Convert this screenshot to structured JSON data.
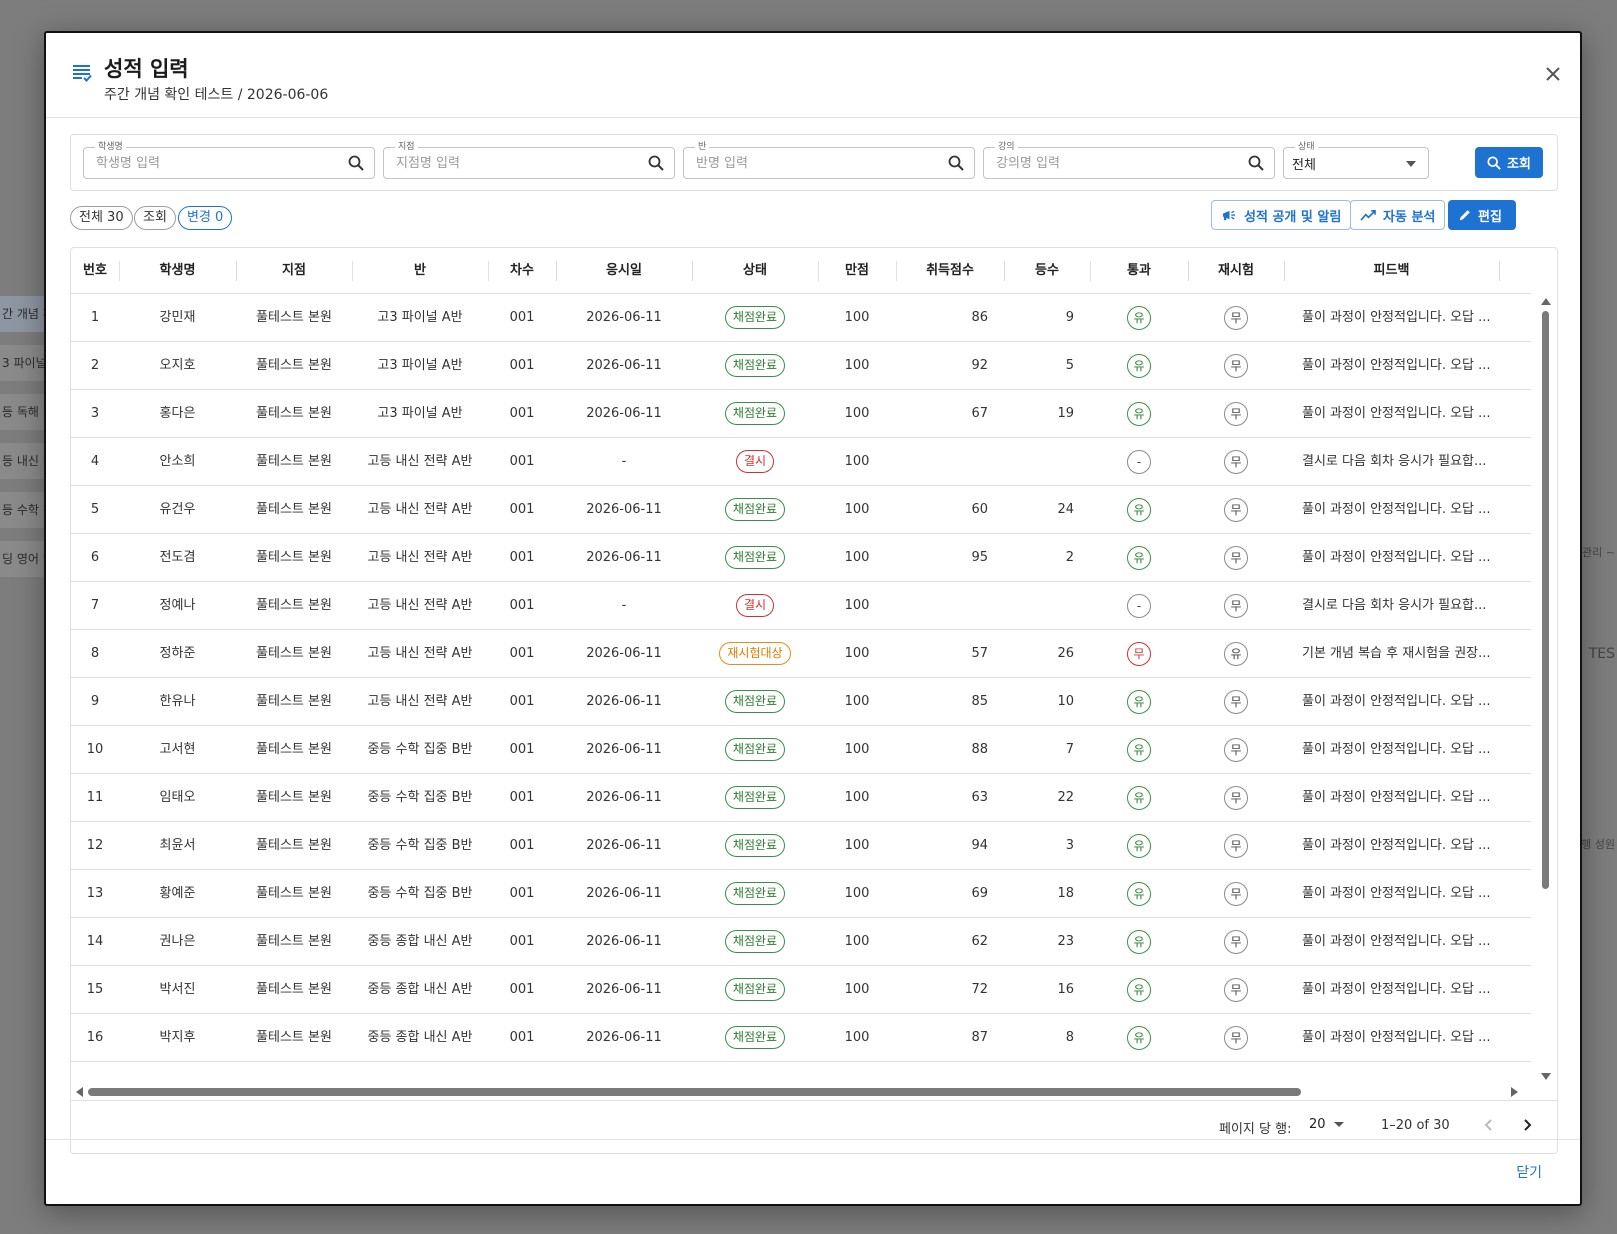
{
  "background": {
    "left_items": [
      "간 개념 확",
      "3 파이널",
      "등 독해 리",
      "등 내신 D",
      "등 수학 집",
      "딩 영어 단"
    ],
    "right_texts": [
      "관리 ~",
      "TES",
      "발행 성원"
    ]
  },
  "dialog": {
    "icon": "list-check-icon",
    "title": "성적 입력",
    "subtitle": "주간 개념 확인 테스트 / 2026-06-06",
    "close_icon": "close-icon"
  },
  "filters": {
    "student": {
      "label": "학생명",
      "placeholder": "학생명 입력",
      "value": ""
    },
    "branch": {
      "label": "지점",
      "placeholder": "지점명 입력",
      "value": ""
    },
    "class": {
      "label": "반",
      "placeholder": "반명 입력",
      "value": ""
    },
    "lecture": {
      "label": "강의",
      "placeholder": "강의명 입력",
      "value": ""
    },
    "status": {
      "label": "상태",
      "value": "전체"
    },
    "query_button": "조회"
  },
  "chips": {
    "total": "전체 30",
    "viewed": "조회",
    "changed": "변경 0"
  },
  "actions": {
    "publish": "성적 공개 및 알림",
    "analyze": "자동 분석",
    "edit": "편집"
  },
  "table": {
    "columns": [
      "번호",
      "학생명",
      "지점",
      "반",
      "차수",
      "응시일",
      "상태",
      "만점",
      "취득점수",
      "등수",
      "통과",
      "재시험",
      "피드백"
    ],
    "rows": [
      {
        "no": "1",
        "name": "강민재",
        "branch": "풀테스트 본원",
        "cls": "고3 파이널 A반",
        "round": "001",
        "date": "2026-06-11",
        "status": "채점완료",
        "status_color": "green",
        "full": "100",
        "score": "86",
        "rank": "9",
        "pass": "유",
        "pass_color": "green",
        "retest": "무",
        "feedback": "풀이 과정이 안정적입니다. 오답 ..."
      },
      {
        "no": "2",
        "name": "오지호",
        "branch": "풀테스트 본원",
        "cls": "고3 파이널 A반",
        "round": "001",
        "date": "2026-06-11",
        "status": "채점완료",
        "status_color": "green",
        "full": "100",
        "score": "92",
        "rank": "5",
        "pass": "유",
        "pass_color": "green",
        "retest": "무",
        "feedback": "풀이 과정이 안정적입니다. 오답 ..."
      },
      {
        "no": "3",
        "name": "홍다은",
        "branch": "풀테스트 본원",
        "cls": "고3 파이널 A반",
        "round": "001",
        "date": "2026-06-11",
        "status": "채점완료",
        "status_color": "green",
        "full": "100",
        "score": "67",
        "rank": "19",
        "pass": "유",
        "pass_color": "green",
        "retest": "무",
        "feedback": "풀이 과정이 안정적입니다. 오답 ..."
      },
      {
        "no": "4",
        "name": "안소희",
        "branch": "풀테스트 본원",
        "cls": "고등 내신 전략 A반",
        "round": "001",
        "date": "-",
        "status": "결시",
        "status_color": "red",
        "full": "100",
        "score": "",
        "rank": "",
        "pass": "-",
        "pass_color": "gray",
        "retest": "무",
        "feedback": "결시로 다음 회차 응시가 필요합..."
      },
      {
        "no": "5",
        "name": "유건우",
        "branch": "풀테스트 본원",
        "cls": "고등 내신 전략 A반",
        "round": "001",
        "date": "2026-06-11",
        "status": "채점완료",
        "status_color": "green",
        "full": "100",
        "score": "60",
        "rank": "24",
        "pass": "유",
        "pass_color": "green",
        "retest": "무",
        "feedback": "풀이 과정이 안정적입니다. 오답 ..."
      },
      {
        "no": "6",
        "name": "전도겸",
        "branch": "풀테스트 본원",
        "cls": "고등 내신 전략 A반",
        "round": "001",
        "date": "2026-06-11",
        "status": "채점완료",
        "status_color": "green",
        "full": "100",
        "score": "95",
        "rank": "2",
        "pass": "유",
        "pass_color": "green",
        "retest": "무",
        "feedback": "풀이 과정이 안정적입니다. 오답 ..."
      },
      {
        "no": "7",
        "name": "정예나",
        "branch": "풀테스트 본원",
        "cls": "고등 내신 전략 A반",
        "round": "001",
        "date": "-",
        "status": "결시",
        "status_color": "red",
        "full": "100",
        "score": "",
        "rank": "",
        "pass": "-",
        "pass_color": "gray",
        "retest": "무",
        "feedback": "결시로 다음 회차 응시가 필요합..."
      },
      {
        "no": "8",
        "name": "정하준",
        "branch": "풀테스트 본원",
        "cls": "고등 내신 전략 A반",
        "round": "001",
        "date": "2026-06-11",
        "status": "재시험대상",
        "status_color": "orange",
        "full": "100",
        "score": "57",
        "rank": "26",
        "pass": "무",
        "pass_color": "red",
        "retest": "유",
        "feedback": "기본 개념 복습 후 재시험을 권장..."
      },
      {
        "no": "9",
        "name": "한유나",
        "branch": "풀테스트 본원",
        "cls": "고등 내신 전략 A반",
        "round": "001",
        "date": "2026-06-11",
        "status": "채점완료",
        "status_color": "green",
        "full": "100",
        "score": "85",
        "rank": "10",
        "pass": "유",
        "pass_color": "green",
        "retest": "무",
        "feedback": "풀이 과정이 안정적입니다. 오답 ..."
      },
      {
        "no": "10",
        "name": "고서현",
        "branch": "풀테스트 본원",
        "cls": "중등 수학 집중 B반",
        "round": "001",
        "date": "2026-06-11",
        "status": "채점완료",
        "status_color": "green",
        "full": "100",
        "score": "88",
        "rank": "7",
        "pass": "유",
        "pass_color": "green",
        "retest": "무",
        "feedback": "풀이 과정이 안정적입니다. 오답 ..."
      },
      {
        "no": "11",
        "name": "임태오",
        "branch": "풀테스트 본원",
        "cls": "중등 수학 집중 B반",
        "round": "001",
        "date": "2026-06-11",
        "status": "채점완료",
        "status_color": "green",
        "full": "100",
        "score": "63",
        "rank": "22",
        "pass": "유",
        "pass_color": "green",
        "retest": "무",
        "feedback": "풀이 과정이 안정적입니다. 오답 ..."
      },
      {
        "no": "12",
        "name": "최윤서",
        "branch": "풀테스트 본원",
        "cls": "중등 수학 집중 B반",
        "round": "001",
        "date": "2026-06-11",
        "status": "채점완료",
        "status_color": "green",
        "full": "100",
        "score": "94",
        "rank": "3",
        "pass": "유",
        "pass_color": "green",
        "retest": "무",
        "feedback": "풀이 과정이 안정적입니다. 오답 ..."
      },
      {
        "no": "13",
        "name": "황예준",
        "branch": "풀테스트 본원",
        "cls": "중등 수학 집중 B반",
        "round": "001",
        "date": "2026-06-11",
        "status": "채점완료",
        "status_color": "green",
        "full": "100",
        "score": "69",
        "rank": "18",
        "pass": "유",
        "pass_color": "green",
        "retest": "무",
        "feedback": "풀이 과정이 안정적입니다. 오답 ..."
      },
      {
        "no": "14",
        "name": "권나은",
        "branch": "풀테스트 본원",
        "cls": "중등 종합 내신 A반",
        "round": "001",
        "date": "2026-06-11",
        "status": "채점완료",
        "status_color": "green",
        "full": "100",
        "score": "62",
        "rank": "23",
        "pass": "유",
        "pass_color": "green",
        "retest": "무",
        "feedback": "풀이 과정이 안정적입니다. 오답 ..."
      },
      {
        "no": "15",
        "name": "박서진",
        "branch": "풀테스트 본원",
        "cls": "중등 종합 내신 A반",
        "round": "001",
        "date": "2026-06-11",
        "status": "채점완료",
        "status_color": "green",
        "full": "100",
        "score": "72",
        "rank": "16",
        "pass": "유",
        "pass_color": "green",
        "retest": "무",
        "feedback": "풀이 과정이 안정적입니다. 오답 ..."
      },
      {
        "no": "16",
        "name": "박지후",
        "branch": "풀테스트 본원",
        "cls": "중등 종합 내신 A반",
        "round": "001",
        "date": "2026-06-11",
        "status": "채점완료",
        "status_color": "green",
        "full": "100",
        "score": "87",
        "rank": "8",
        "pass": "유",
        "pass_color": "green",
        "retest": "무",
        "feedback": "풀이 과정이 안정적입니다. 오답 ..."
      }
    ]
  },
  "pagination": {
    "rows_per_page_label": "페이지 당 행:",
    "rows_per_page": "20",
    "range": "1–20 of 30"
  },
  "footer": {
    "close_label": "닫기"
  },
  "colors": {
    "primary": "#1e73d2",
    "success": "#2e7d32",
    "error": "#d32f2f",
    "warning": "#e07a00"
  }
}
